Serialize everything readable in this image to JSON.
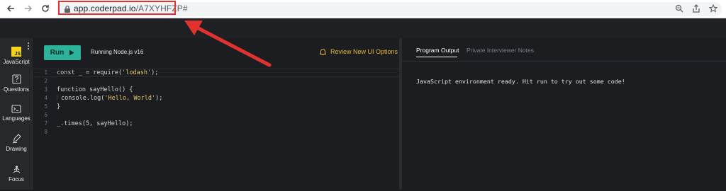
{
  "browser": {
    "url_host": "app.coderpad.io",
    "url_path": "/A7XYHFZP#"
  },
  "sidebar": {
    "items": [
      {
        "label": "JavaScript",
        "icon": "javascript-icon"
      },
      {
        "label": "Questions",
        "icon": "question-icon"
      },
      {
        "label": "Languages",
        "icon": "terminal-icon"
      },
      {
        "label": "Drawing",
        "icon": "pen-icon"
      },
      {
        "label": "Focus",
        "icon": "focus-icon"
      }
    ],
    "js_badge_text": "JS"
  },
  "editor": {
    "run_label": "Run",
    "status": "Running Node.js v16",
    "review_label": "Review New UI Options",
    "line_numbers": [
      "1",
      "2",
      "3",
      "4",
      "5",
      "6",
      "7",
      "8"
    ],
    "code": {
      "l1a": "const ",
      "l1b": "_",
      "l1c": " = require(",
      "l1d": "'lodash'",
      "l1e": ");",
      "l3": "function sayHello() {",
      "l4a": "console.log(",
      "l4b": "'Hello, World'",
      "l4c": ");",
      "l5": "}",
      "l7": "_.times(5, sayHello);"
    }
  },
  "output": {
    "tab_active": "Program Output",
    "tab_inactive": "Private Interviewer Notes",
    "message": "JavaScript environment ready. Hit run to try out some code!"
  },
  "colors": {
    "run_button": "#2bb39b",
    "review_link": "#e8b63a",
    "annotation": "#e2322f"
  }
}
